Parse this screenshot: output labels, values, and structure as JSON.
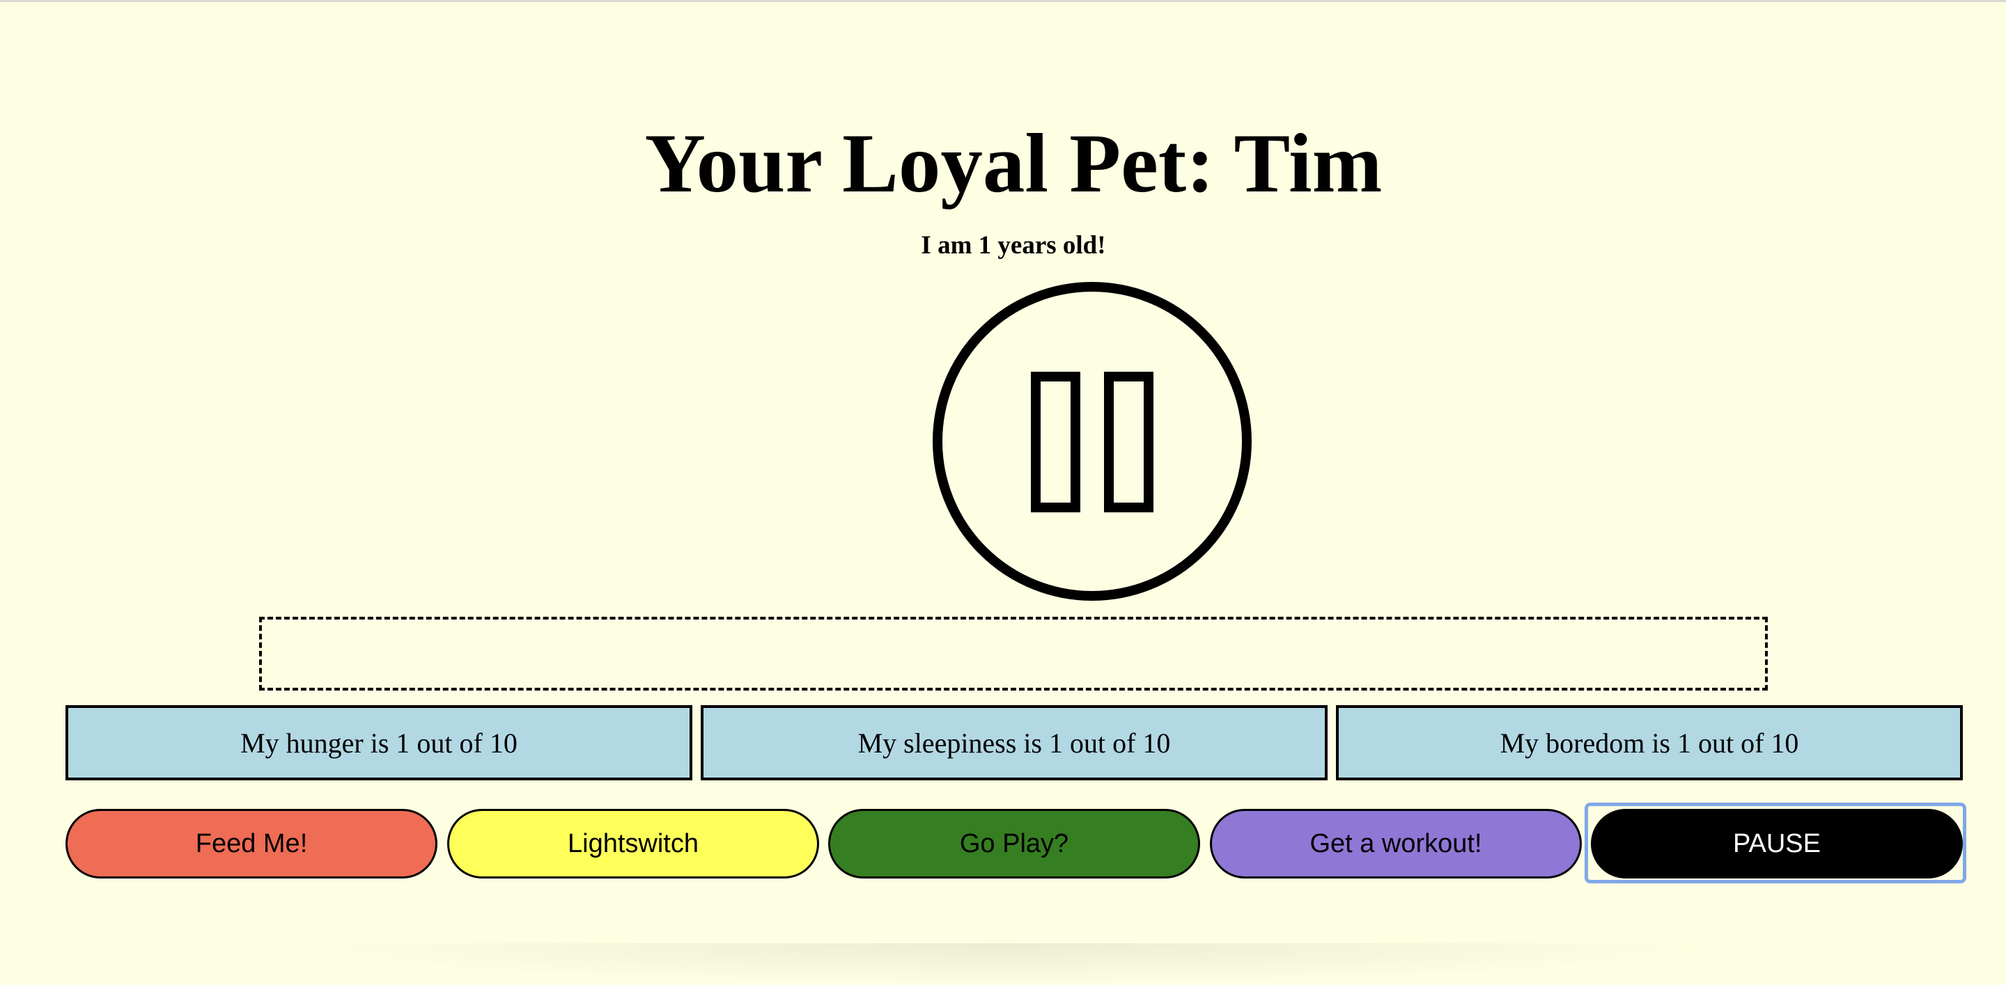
{
  "pet": {
    "title": "Your Loyal Pet: Tim",
    "age_text": "I am 1 years old!",
    "face_icon": "pause-face-icon",
    "message": ""
  },
  "stats": [
    {
      "label": "My hunger is 1 out of 10",
      "value": 1,
      "max": 10
    },
    {
      "label": "My sleepiness is 1 out of 10",
      "value": 1,
      "max": 10
    },
    {
      "label": "My boredom is 1 out of 10",
      "value": 1,
      "max": 10
    }
  ],
  "buttons": [
    {
      "label": "Feed Me!",
      "color": "#ef6c55"
    },
    {
      "label": "Lightswitch",
      "color": "#ffff5a"
    },
    {
      "label": "Go Play?",
      "color": "#367e22"
    },
    {
      "label": "Get a workout!",
      "color": "#8f77d6"
    },
    {
      "label": "PAUSE",
      "color": "#000000"
    }
  ],
  "colors": {
    "background": "#fefee2",
    "stat_background": "#b2d8e4",
    "focus_ring": "#7fa8e8"
  }
}
